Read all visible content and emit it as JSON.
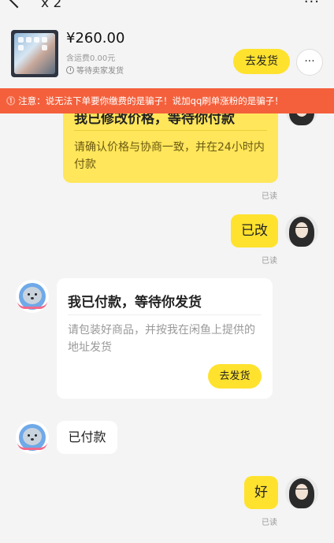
{
  "nav": {
    "title": "x 2",
    "more": "···"
  },
  "product": {
    "price": "¥260.00",
    "shipping": "含运费0.00元",
    "status": "等待卖家发货",
    "ship_button": "去发货",
    "more_button": "···"
  },
  "warning": "⓵ 注意：说无法下单要你缴费的是骗子！说加qq刷单涨粉的是骗子！",
  "messages": {
    "price_card": {
      "header": "我已修改价格，等待你付款",
      "body": "请确认价格与协商一致，并在24小时内付款",
      "read": "已读"
    },
    "me_changed": {
      "text": "已改",
      "read": "已读"
    },
    "paid_card": {
      "header": "我已付款，等待你发货",
      "body": "请包装好商品，并按我在闲鱼上提供的地址发货",
      "button": "去发货"
    },
    "paid_short": {
      "text": "已付款"
    },
    "me_ok": {
      "text": "好",
      "read": "已读"
    }
  },
  "colors": {
    "accent": "#ffe22e",
    "warning": "#f4603c"
  }
}
